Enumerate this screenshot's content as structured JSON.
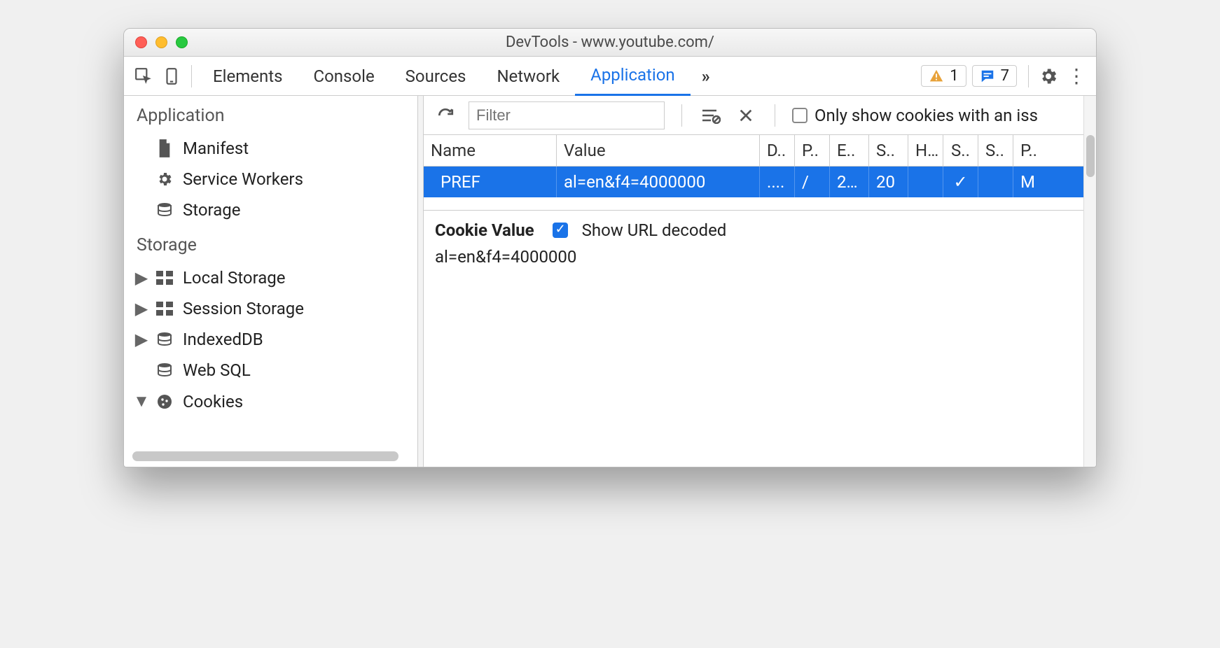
{
  "window": {
    "title": "DevTools - www.youtube.com/"
  },
  "tabs": {
    "items": [
      "Elements",
      "Console",
      "Sources",
      "Network",
      "Application"
    ],
    "active": "Application",
    "more": "»"
  },
  "badges": {
    "warn_count": "1",
    "msg_count": "7"
  },
  "sidebar": {
    "sections": [
      {
        "title": "Application",
        "items": [
          {
            "icon": "file",
            "label": "Manifest",
            "expandable": false
          },
          {
            "icon": "gear",
            "label": "Service Workers",
            "expandable": false
          },
          {
            "icon": "db",
            "label": "Storage",
            "expandable": false
          }
        ]
      },
      {
        "title": "Storage",
        "items": [
          {
            "icon": "grid",
            "label": "Local Storage",
            "expandable": true,
            "expanded": false
          },
          {
            "icon": "grid",
            "label": "Session Storage",
            "expandable": true,
            "expanded": false
          },
          {
            "icon": "db",
            "label": "IndexedDB",
            "expandable": true,
            "expanded": false
          },
          {
            "icon": "db",
            "label": "Web SQL",
            "expandable": false
          },
          {
            "icon": "cookie",
            "label": "Cookies",
            "expandable": true,
            "expanded": true
          }
        ]
      }
    ]
  },
  "toolbar": {
    "filter_placeholder": "Filter",
    "only_label": "Only show cookies with an iss"
  },
  "table": {
    "columns": [
      "Name",
      "Value",
      "D..",
      "P..",
      "E..",
      "S..",
      "H..",
      "S..",
      "S..",
      "P.."
    ],
    "rows": [
      {
        "name": "PREF",
        "value": "al=en&f4=4000000",
        "d": "....",
        "p": "/",
        "e": "2…",
        "s1": "20",
        "h": "",
        "s2": "✓",
        "s3": "",
        "pr": "M"
      }
    ]
  },
  "detail": {
    "title": "Cookie Value",
    "decoded_label": "Show URL decoded",
    "decoded_checked": true,
    "value": "al=en&f4=4000000"
  }
}
